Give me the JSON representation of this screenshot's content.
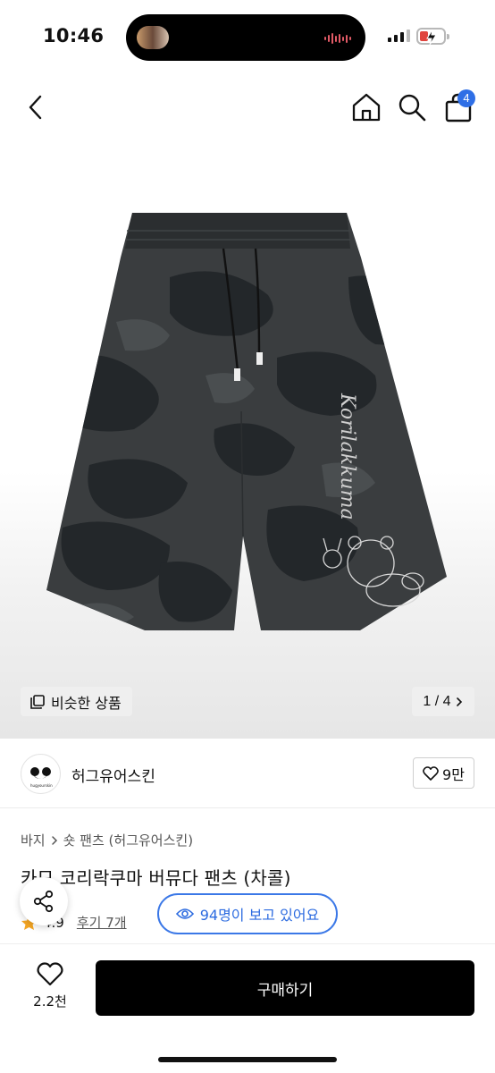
{
  "status_bar": {
    "time": "10:46"
  },
  "nav": {
    "cart_count": "4"
  },
  "gallery": {
    "similar_label": "비슷한 상품",
    "page_counter": "1 / 4",
    "image_text": "Korilakkuma"
  },
  "brand": {
    "name": "허그유어스킨",
    "logo_caption": "hugyourskin",
    "likes": "9만"
  },
  "breadcrumb": {
    "category": "바지",
    "subcategory": "숏 팬츠 (허그유어스킨)"
  },
  "product": {
    "title": "카모 코리락쿠마 버뮤다 팬츠 (차콜)",
    "rating": "4.9",
    "reviews": "후기 7개"
  },
  "viewers": {
    "text": "94명이 보고 있어요"
  },
  "bottom_bar": {
    "wish_count": "2.2천",
    "buy_label": "구매하기"
  },
  "colors": {
    "accent_blue": "#3b78e7",
    "badge_blue": "#2f6fe6",
    "star": "#f5a623",
    "buy_button": "#000000",
    "pants_base": "#3a3d3f",
    "pants_camo": "#23272a"
  }
}
